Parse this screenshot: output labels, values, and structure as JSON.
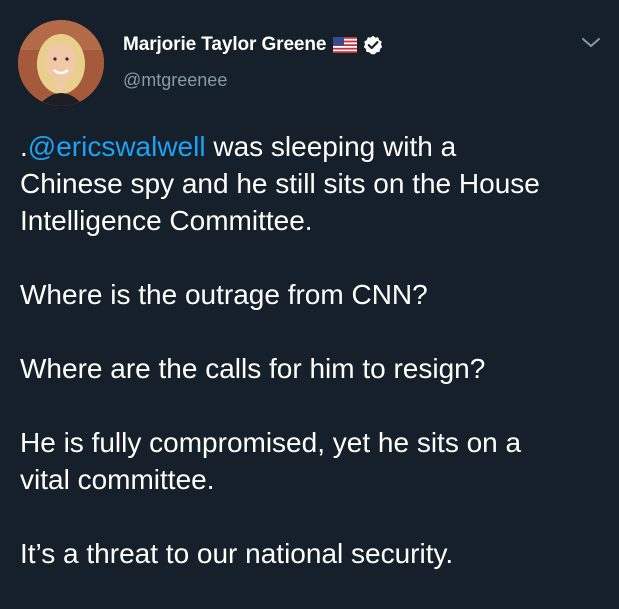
{
  "author": {
    "display_name": "Marjorie Taylor Greene",
    "handle": "@mtgreenee",
    "flag_icon": "us-flag-icon",
    "verified_icon": "verified-badge-icon"
  },
  "menu_icon": "chevron-down-icon",
  "tweet": {
    "p1_prefix": ".",
    "p1_mention": "@ericswalwell",
    "p1_line1_rest": " was sleeping with a",
    "p1_line2": "Chinese spy and he still sits on the House",
    "p1_line3": "Intelligence Committee.",
    "p2": "Where is the outrage from CNN?",
    "p3": "Where are the calls for him to resign?",
    "p4_line1": "He is fully compromised, yet he sits on a",
    "p4_line2": "vital committee.",
    "p5": "It’s a threat to our national security."
  },
  "colors": {
    "background": "#15202b",
    "text": "#ffffff",
    "secondary": "#8899a6",
    "link": "#1da1f2"
  }
}
